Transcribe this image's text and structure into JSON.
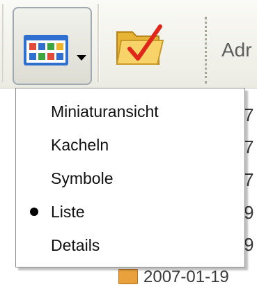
{
  "toolbar": {
    "views_button": {
      "icon": "view-grid-icon",
      "has_dropdown": true
    },
    "folder_button": {
      "icon": "folder-check-icon"
    },
    "address_label": "Adr"
  },
  "menu": {
    "items": [
      {
        "label": "Miniaturansicht",
        "selected": false
      },
      {
        "label": "Kacheln",
        "selected": false
      },
      {
        "label": "Symbole",
        "selected": false
      },
      {
        "label": "Liste",
        "selected": true
      },
      {
        "label": "Details",
        "selected": false
      }
    ]
  },
  "background_list": {
    "fragments": [
      "7",
      "7",
      "7",
      "9",
      "9"
    ],
    "bottom_row_text": "2007-01-19"
  },
  "colors": {
    "toolbar_bg": "#ecebe3",
    "menu_border": "#8d8d8d",
    "icon_blue": "#2f6fd0",
    "folder_yellow": "#f4c84a",
    "check_red": "#e0261a"
  }
}
